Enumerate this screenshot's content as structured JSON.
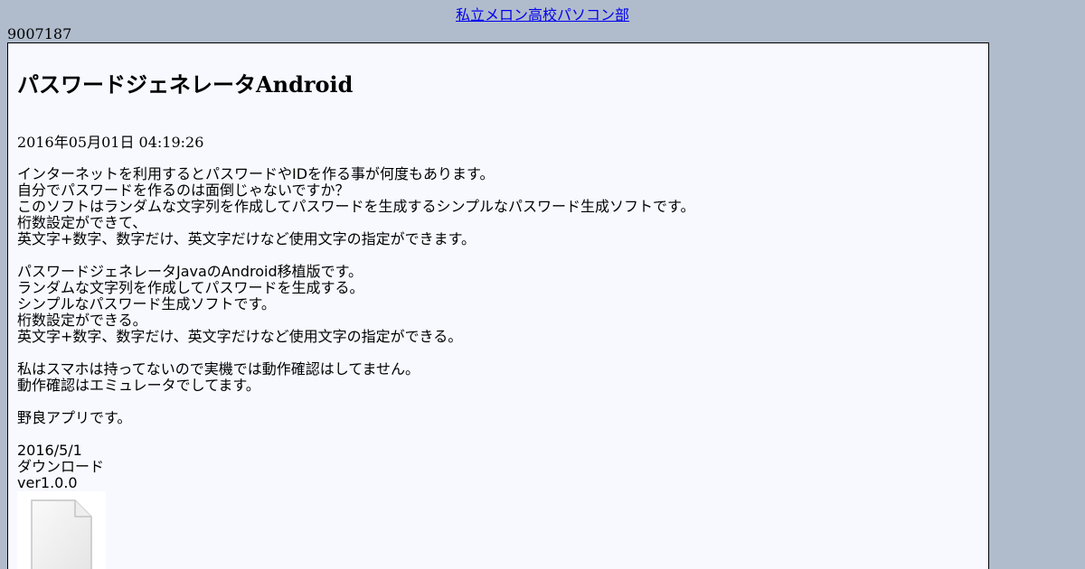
{
  "site": {
    "header_link": "私立メロン高校パソコン部",
    "counter": "9007187"
  },
  "article": {
    "title": "パスワードジェネレータAndroid",
    "date": "2016年05月01日 04:19:26",
    "paragraphs": [
      [
        "インターネットを利用するとパスワードやIDを作る事が何度もあります。",
        "自分でパスワードを作るのは面倒じゃないですか？",
        "このソフトはランダムな文字列を作成してパスワードを生成するシンプルなパスワード生成ソフトです。",
        "桁数設定ができて、",
        "英文字+数字、数字だけ、英文字だけなど使用文字の指定ができます。"
      ],
      [
        "パスワードジェネレータJavaのAndroid移植版です。",
        "ランダムな文字列を作成してパスワードを生成する。",
        "シンプルなパスワード生成ソフトです。",
        "桁数設定ができる。",
        "英文字+数字、数字だけ、英文字だけなど使用文字の指定ができる。"
      ],
      [
        "私はスマホは持ってないので実機では動作確認はしてません。",
        "動作確認はエミュレータでしてます。"
      ],
      [
        "野良アプリです。"
      ]
    ],
    "release_date": "2016/5/1",
    "download_label": "ダウンロード",
    "version": "ver1.0.0",
    "file_icon": "file-icon"
  }
}
